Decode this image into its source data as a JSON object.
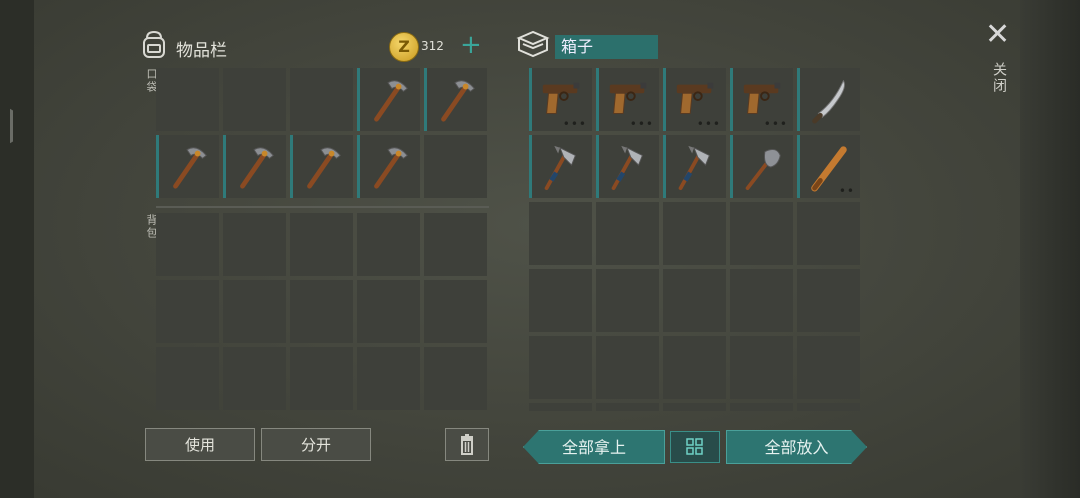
{
  "inventory": {
    "title": "物品栏",
    "coins": "312",
    "pocket_label": "口袋",
    "backpack_label": "背包",
    "pocket_slots": [
      {
        "item": ""
      },
      {
        "item": ""
      },
      {
        "item": ""
      },
      {
        "item": "pickaxe"
      },
      {
        "item": "pickaxe"
      },
      {
        "item": "pickaxe"
      },
      {
        "item": "pickaxe"
      },
      {
        "item": "pickaxe"
      },
      {
        "item": "pickaxe"
      },
      {
        "item": ""
      }
    ],
    "backpack_slots": 15
  },
  "box": {
    "title": "箱子",
    "slots": [
      {
        "item": "pistol",
        "dots": "•••"
      },
      {
        "item": "pistol",
        "dots": "•••"
      },
      {
        "item": "pistol",
        "dots": "•••"
      },
      {
        "item": "pistol",
        "dots": "•••"
      },
      {
        "item": "machete",
        "dots": ""
      },
      {
        "item": "hatchet",
        "dots": ""
      },
      {
        "item": "hatchet",
        "dots": ""
      },
      {
        "item": "hatchet",
        "dots": ""
      },
      {
        "item": "shovel",
        "dots": ""
      },
      {
        "item": "baseball-bat",
        "dots": "••"
      }
    ],
    "empty_rows": 3
  },
  "buttons": {
    "use": "使用",
    "split": "分开",
    "take_all": "全部拿上",
    "put_all": "全部放入"
  },
  "close_label": "关闭",
  "colors": {
    "accent": "#2d7571",
    "slot": "#3e403a",
    "background": "#45473e"
  }
}
